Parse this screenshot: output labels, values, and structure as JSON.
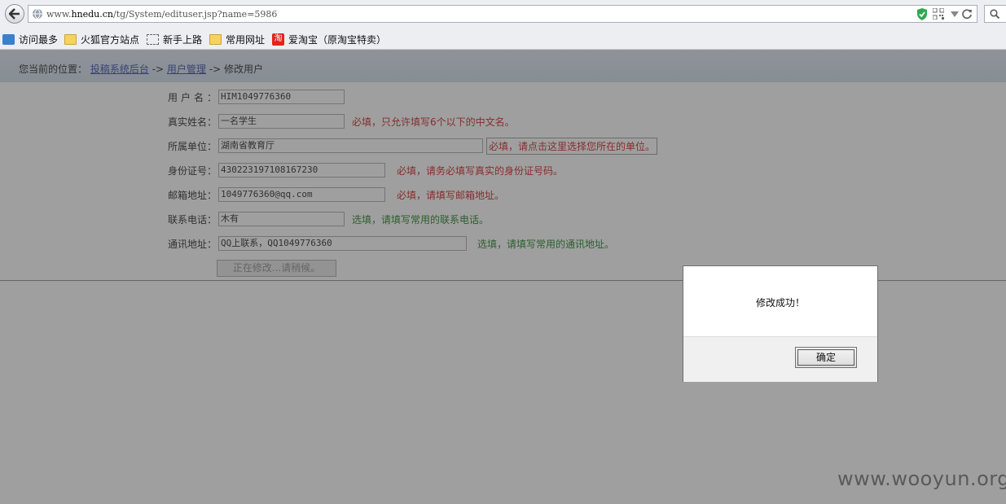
{
  "browser": {
    "url_prefix": "www.",
    "url_domain": "hnedu.cn",
    "url_path": "/tg/System/edituser.jsp?name=5986",
    "bookmarks": [
      {
        "label": "访问最多",
        "icon": "most-visited-icon"
      },
      {
        "label": "火狐官方站点",
        "icon": "folder-icon"
      },
      {
        "label": "新手上路",
        "icon": "dashed-box-icon"
      },
      {
        "label": "常用网址",
        "icon": "folder-icon"
      },
      {
        "label": "爱淘宝（原淘宝特卖）",
        "icon": "taobao-icon",
        "icon_text": "淘"
      }
    ]
  },
  "breadcrumb": {
    "prefix": "您当前的位置：",
    "items": [
      "投稿系统后台",
      "用户管理",
      "修改用户"
    ],
    "separator": "->"
  },
  "form": {
    "rows": [
      {
        "label": "用户名：",
        "value": "HIM1049776360",
        "hint": "",
        "hint_type": ""
      },
      {
        "label": "真实姓名：",
        "value": "一名学生",
        "hint": "必填，只允许填写6个以下的中文名。",
        "hint_type": "req"
      },
      {
        "label": "所属单位：",
        "value": "湖南省教育厅",
        "hint": "必填，请点击这里选择您所在的单位。",
        "hint_type": "req"
      },
      {
        "label": "身份证号：",
        "value": "430223197108167230",
        "hint": "必填，请务必填写真实的身份证号码。",
        "hint_type": "req"
      },
      {
        "label": "邮箱地址：",
        "value": "1049776360@qq.com",
        "hint": "必填，请填写邮箱地址。",
        "hint_type": "req"
      },
      {
        "label": "联系电话：",
        "value": "木有",
        "hint": "选填，请填写常用的联系电话。",
        "hint_type": "opt"
      },
      {
        "label": "通讯地址：",
        "value": "QQ上联系，QQ1049776360",
        "hint": "选填，请填写常用的通讯地址。",
        "hint_type": "opt"
      }
    ],
    "submit_label": "正在修改...请稍候。"
  },
  "dialog": {
    "message": "修改成功！",
    "ok_label": "确定"
  },
  "watermark": "www.wooyun.org",
  "colors": {
    "required_hint": "#d01818",
    "optional_hint": "#1c7a1c",
    "link": "#3344aa"
  }
}
